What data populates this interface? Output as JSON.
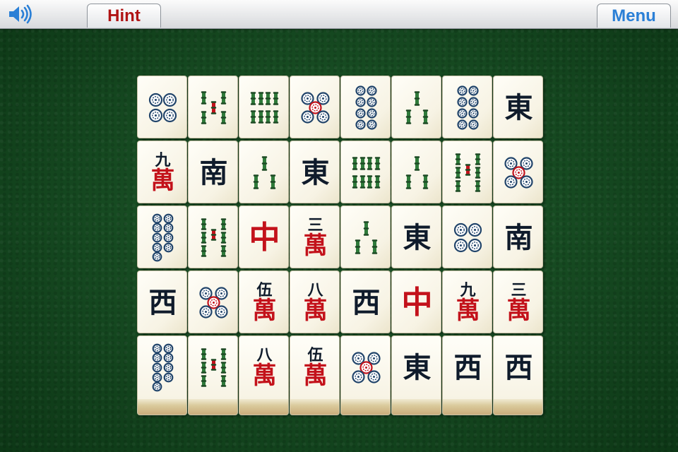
{
  "toolbar": {
    "hint_label": "Hint",
    "menu_label": "Menu",
    "speaker_icon": "speaker-icon"
  },
  "colors": {
    "felt": "#1a4d23",
    "hint_text": "#b01414",
    "menu_text": "#2a7fd6",
    "tile_face": "#fffef8",
    "character_red": "#c3121b",
    "ink": "#0f1b2b",
    "bamboo_green": "#2f7a3a",
    "circle_blue": "#22456b"
  },
  "board": {
    "rows": 5,
    "cols": 8,
    "tiles": [
      [
        {
          "suit": "circle",
          "n": 4
        },
        {
          "suit": "bamboo",
          "n": 5
        },
        {
          "suit": "bamboo",
          "n": 8
        },
        {
          "suit": "circle",
          "n": 5
        },
        {
          "suit": "circle",
          "n": 8
        },
        {
          "suit": "bamboo",
          "n": 3
        },
        {
          "suit": "circle",
          "n": 8
        },
        {
          "suit": "wind",
          "glyph": "東"
        }
      ],
      [
        {
          "suit": "char",
          "num": "九",
          "wan": "萬"
        },
        {
          "suit": "wind",
          "glyph": "南"
        },
        {
          "suit": "bamboo",
          "n": 3
        },
        {
          "suit": "wind",
          "glyph": "東"
        },
        {
          "suit": "bamboo",
          "n": 8
        },
        {
          "suit": "bamboo",
          "n": 3
        },
        {
          "suit": "bamboo",
          "n": 7
        },
        {
          "suit": "circle",
          "n": 5
        }
      ],
      [
        {
          "suit": "circle",
          "n": 9
        },
        {
          "suit": "bamboo",
          "n": 7
        },
        {
          "suit": "dragon",
          "glyph": "中"
        },
        {
          "suit": "char",
          "num": "三",
          "wan": "萬"
        },
        {
          "suit": "bamboo",
          "n": 3
        },
        {
          "suit": "wind",
          "glyph": "東"
        },
        {
          "suit": "circle",
          "n": 4
        },
        {
          "suit": "wind",
          "glyph": "南"
        }
      ],
      [
        {
          "suit": "wind",
          "glyph": "西"
        },
        {
          "suit": "circle",
          "n": 5
        },
        {
          "suit": "char",
          "num": "伍",
          "wan": "萬"
        },
        {
          "suit": "char",
          "num": "八",
          "wan": "萬"
        },
        {
          "suit": "wind",
          "glyph": "西"
        },
        {
          "suit": "dragon",
          "glyph": "中"
        },
        {
          "suit": "char",
          "num": "九",
          "wan": "萬"
        },
        {
          "suit": "char",
          "num": "三",
          "wan": "萬"
        }
      ],
      [
        {
          "suit": "circle",
          "n": 9
        },
        {
          "suit": "bamboo",
          "n": 7
        },
        {
          "suit": "char",
          "num": "八",
          "wan": "萬"
        },
        {
          "suit": "char",
          "num": "伍",
          "wan": "萬"
        },
        {
          "suit": "circle",
          "n": 5
        },
        {
          "suit": "wind",
          "glyph": "東"
        },
        {
          "suit": "wind",
          "glyph": "西"
        },
        {
          "suit": "wind",
          "glyph": "西"
        }
      ]
    ]
  }
}
